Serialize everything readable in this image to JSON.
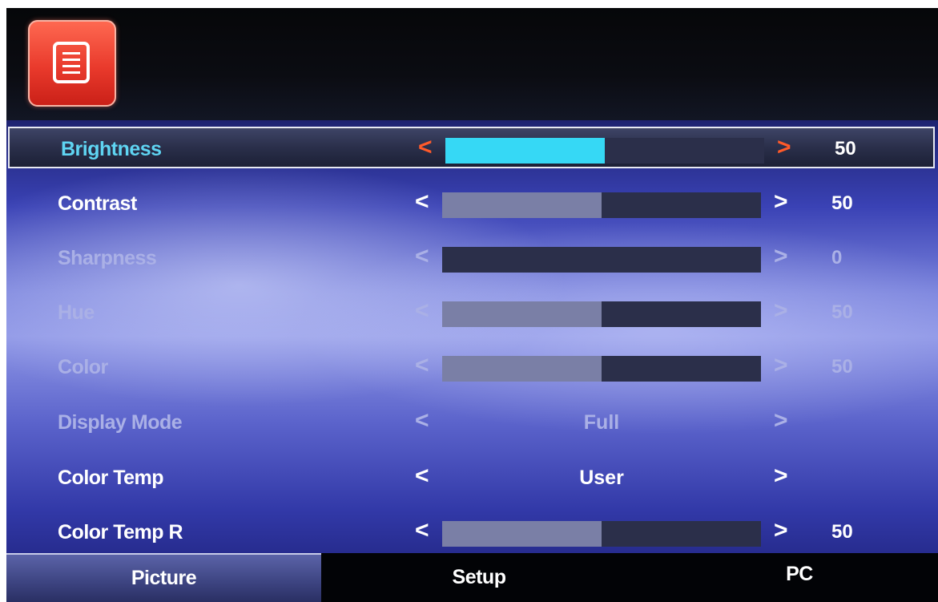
{
  "header": {
    "icon": "menu-list-icon"
  },
  "menu": {
    "items": [
      {
        "label": "Brightness",
        "type": "slider",
        "value": "50",
        "level": 50,
        "selected": true,
        "enabled": true
      },
      {
        "label": "Contrast",
        "type": "slider",
        "value": "50",
        "level": 50,
        "selected": false,
        "enabled": true
      },
      {
        "label": "Sharpness",
        "type": "slider",
        "value": "0",
        "level": 0,
        "selected": false,
        "enabled": false
      },
      {
        "label": "Hue",
        "type": "slider",
        "value": "50",
        "level": 50,
        "selected": false,
        "enabled": false
      },
      {
        "label": "Color",
        "type": "slider",
        "value": "50",
        "level": 50,
        "selected": false,
        "enabled": false
      },
      {
        "label": "Display Mode",
        "type": "option",
        "value": "Full",
        "selected": false,
        "enabled": false
      },
      {
        "label": "Color Temp",
        "type": "option",
        "value": "User",
        "selected": false,
        "enabled": true
      },
      {
        "label": "Color Temp  R",
        "type": "slider",
        "value": "50",
        "level": 50,
        "selected": false,
        "enabled": true
      }
    ]
  },
  "tabs": [
    {
      "label": "Picture",
      "active": true
    },
    {
      "label": "Setup",
      "active": false
    },
    {
      "label": "PC",
      "active": false
    }
  ],
  "arrows": {
    "left": "<",
    "right": ">"
  },
  "colors": {
    "selected_label": "#5fd4f2",
    "selected_fill": "#36d8f5",
    "selected_arrow": "#ff5a2a",
    "enabled_text": "#ffffff",
    "disabled_text": "#aab0e6",
    "normal_fill": "#7a7fa6"
  }
}
